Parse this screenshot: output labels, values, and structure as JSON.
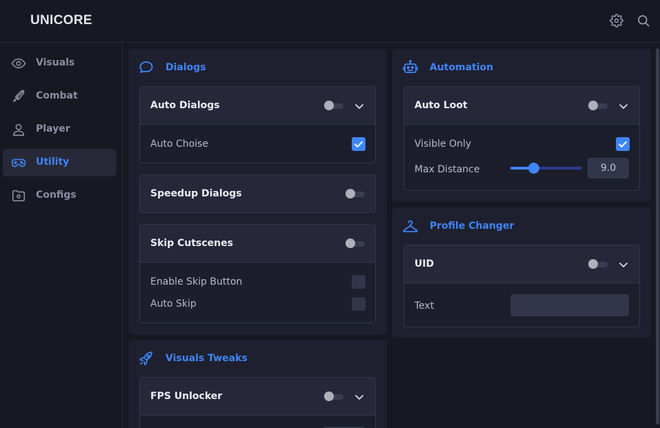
{
  "app": {
    "title": "UNICORE"
  },
  "header": {
    "settings_icon": "gear-icon",
    "search_icon": "search-icon"
  },
  "sidebar": {
    "items": [
      {
        "label": "Visuals",
        "icon": "eye-icon",
        "active": false
      },
      {
        "label": "Combat",
        "icon": "sword-icon",
        "active": false
      },
      {
        "label": "Player",
        "icon": "user-icon",
        "active": false
      },
      {
        "label": "Utility",
        "icon": "gamepad-icon",
        "active": true
      },
      {
        "label": "Configs",
        "icon": "folder-settings-icon",
        "active": false
      }
    ]
  },
  "panels": {
    "dialogs": {
      "title": "Dialogs",
      "icon": "chat-bubble-icon",
      "auto_dialogs": {
        "title": "Auto Dialogs",
        "enabled": false,
        "options": {
          "auto_choise": {
            "label": "Auto Choise",
            "checked": true
          }
        }
      },
      "speedup_dialogs": {
        "title": "Speedup Dialogs",
        "enabled": false
      },
      "skip_cutscenes": {
        "title": "Skip Cutscenes",
        "enabled": false,
        "options": {
          "enable_skip_button": {
            "label": "Enable Skip Button",
            "checked": false
          },
          "auto_skip": {
            "label": "Auto Skip",
            "checked": false
          }
        }
      }
    },
    "visuals_tweaks": {
      "title": "Visuals Tweaks",
      "icon": "rocket-icon",
      "fps_unlocker": {
        "title": "FPS Unlocker",
        "enabled": false
      }
    },
    "automation": {
      "title": "Automation",
      "icon": "robot-icon",
      "auto_loot": {
        "title": "Auto Loot",
        "enabled": false,
        "visible_only": {
          "label": "Visible Only",
          "checked": true
        },
        "max_distance": {
          "label": "Max Distance",
          "value": "9.0",
          "fraction": 0.3
        }
      }
    },
    "profile_changer": {
      "title": "Profile Changer",
      "icon": "hanger-icon",
      "uid": {
        "title": "UID",
        "enabled": false,
        "text": {
          "label": "Text",
          "value": ""
        }
      }
    }
  },
  "colors": {
    "accent": "#3f86f7",
    "background": "#171822",
    "panel": "#1e2030",
    "card_header": "#262839"
  }
}
